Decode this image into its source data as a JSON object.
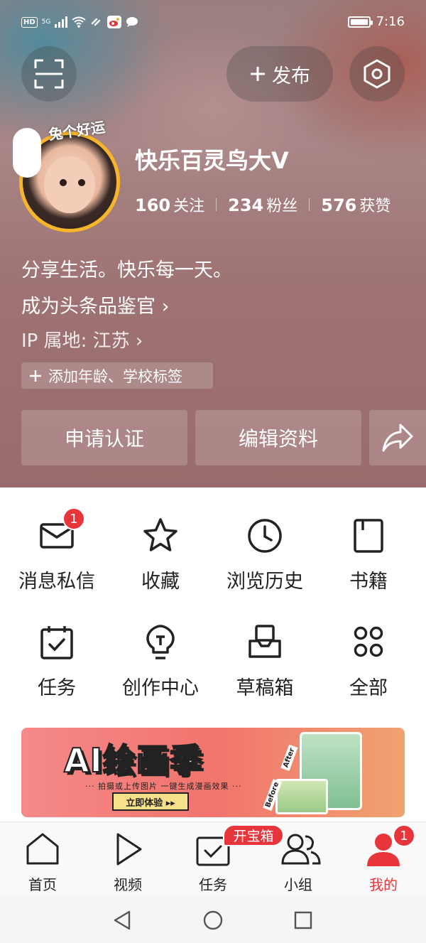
{
  "status_bar": {
    "network": "5G",
    "hd": "HD",
    "time": "7:16"
  },
  "header": {
    "publish_label": "发布",
    "username": "快乐百灵鸟大V",
    "avatar_badge": "兔个好运",
    "stats": [
      {
        "value": "160",
        "label": "关注"
      },
      {
        "value": "234",
        "label": "粉丝"
      },
      {
        "value": "576",
        "label": "获赞"
      }
    ],
    "bio": "分享生活。快乐每一天。",
    "link": "成为头条品鉴官 ›",
    "ip": "IP 属地: 江苏 ›",
    "tag_button": "添加年龄、学校标签",
    "actions": {
      "certify": "申请认证",
      "edit": "编辑资料"
    }
  },
  "grid": [
    {
      "icon": "message-icon",
      "label": "消息私信",
      "badge": "1"
    },
    {
      "icon": "star-icon",
      "label": "收藏"
    },
    {
      "icon": "clock-icon",
      "label": "浏览历史"
    },
    {
      "icon": "book-icon",
      "label": "书籍"
    },
    {
      "icon": "task-calendar-icon",
      "label": "任务"
    },
    {
      "icon": "lightbulb-icon",
      "label": "创作中心"
    },
    {
      "icon": "drafts-box-icon",
      "label": "草稿箱"
    },
    {
      "icon": "grid-dots-icon",
      "label": "全部"
    }
  ],
  "banner": {
    "title": "AI绘画季",
    "subtitle": "··· 拍摄或上传图片 一键生成漫画效果 ···",
    "cta": "立即体验 ▸▸",
    "before": "Before",
    "after": "After"
  },
  "bottom_nav": {
    "items": [
      {
        "label": "首页"
      },
      {
        "label": "视频"
      },
      {
        "label": "任务"
      },
      {
        "label": "小组"
      },
      {
        "label": "我的"
      }
    ],
    "pill": "开宝箱",
    "badge": "1",
    "active_color": "#e8343b"
  }
}
